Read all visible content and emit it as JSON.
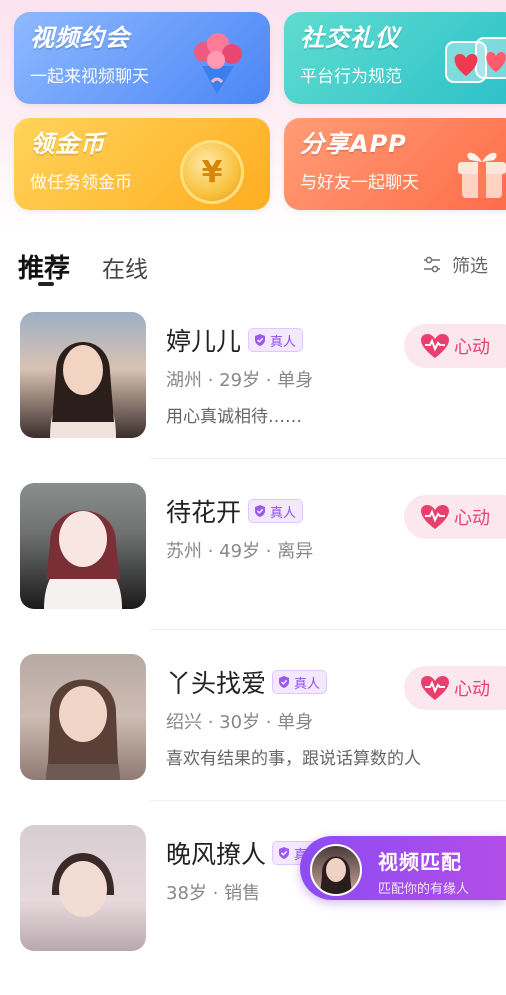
{
  "feature_tiles": [
    {
      "title": "视频约会",
      "subtitle": "一起来视频聊天"
    },
    {
      "title": "社交礼仪",
      "subtitle": "平台行为规范"
    },
    {
      "title": "领金币",
      "subtitle": "做任务领金币"
    },
    {
      "title": "分享APP",
      "subtitle": "与好友一起聊天"
    }
  ],
  "tabs": {
    "recommend": "推荐",
    "online": "在线",
    "filter": "筛选"
  },
  "verified_label": "真人",
  "like_label": "心动",
  "users": [
    {
      "name": "婷儿儿",
      "meta": "湖州 · 29岁 · 单身",
      "bio": "用心真诚相待……"
    },
    {
      "name": "待花开",
      "meta": "苏州 · 49岁 · 离异",
      "bio": ""
    },
    {
      "name": "丫头找爱",
      "meta": "绍兴 · 30岁 · 单身",
      "bio": "喜欢有结果的事，跟说话算数的人"
    },
    {
      "name": "晚风撩人",
      "meta": "38岁 · 销售",
      "bio": ""
    }
  ],
  "video_match": {
    "title": "视频匹配",
    "subtitle": "匹配你的有缘人"
  },
  "colors": {
    "accent_pink": "#ea3f6e",
    "badge_purple": "#8d4ff0",
    "match_purple": "#8c4cf3"
  }
}
